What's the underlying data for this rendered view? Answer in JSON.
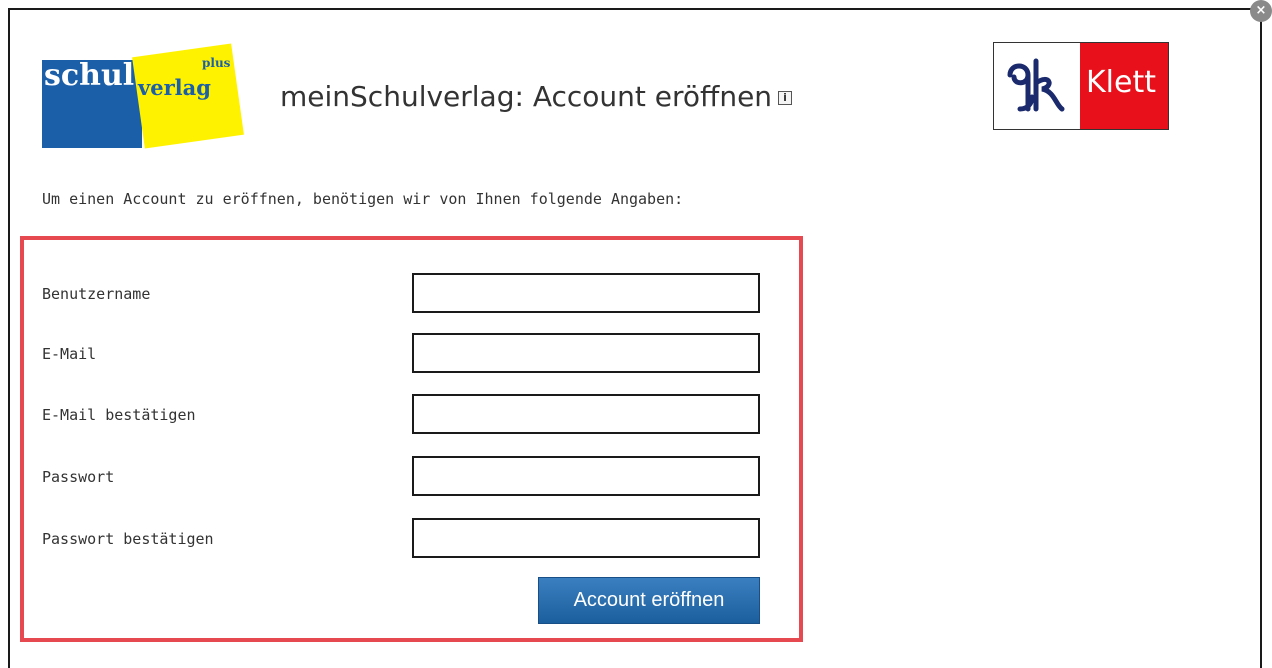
{
  "header": {
    "title": "meinSchulverlag: Account eröffnen",
    "info_icon": "i",
    "close_icon": "×"
  },
  "logos": {
    "schulverlag": {
      "part1": "schul",
      "part2": "verlag",
      "part3": "plus",
      "colors": {
        "blue": "#1b5fa8",
        "yellow": "#fff200"
      }
    },
    "klett": {
      "text": "Klett",
      "colors": {
        "red": "#e8101a",
        "navy": "#1a2a6c"
      }
    }
  },
  "intro": "Um einen Account zu eröffnen, benötigen wir von Ihnen folgende Angaben:",
  "form": {
    "fields": [
      {
        "label": "Benutzername",
        "value": ""
      },
      {
        "label": "E-Mail",
        "value": ""
      },
      {
        "label": "E-Mail bestätigen",
        "value": ""
      },
      {
        "label": "Passwort",
        "value": ""
      },
      {
        "label": "Passwort bestätigen",
        "value": ""
      }
    ],
    "submit_label": "Account eröffnen"
  },
  "colors": {
    "highlight_border": "#e64a50",
    "button": "#1c5f9e"
  }
}
